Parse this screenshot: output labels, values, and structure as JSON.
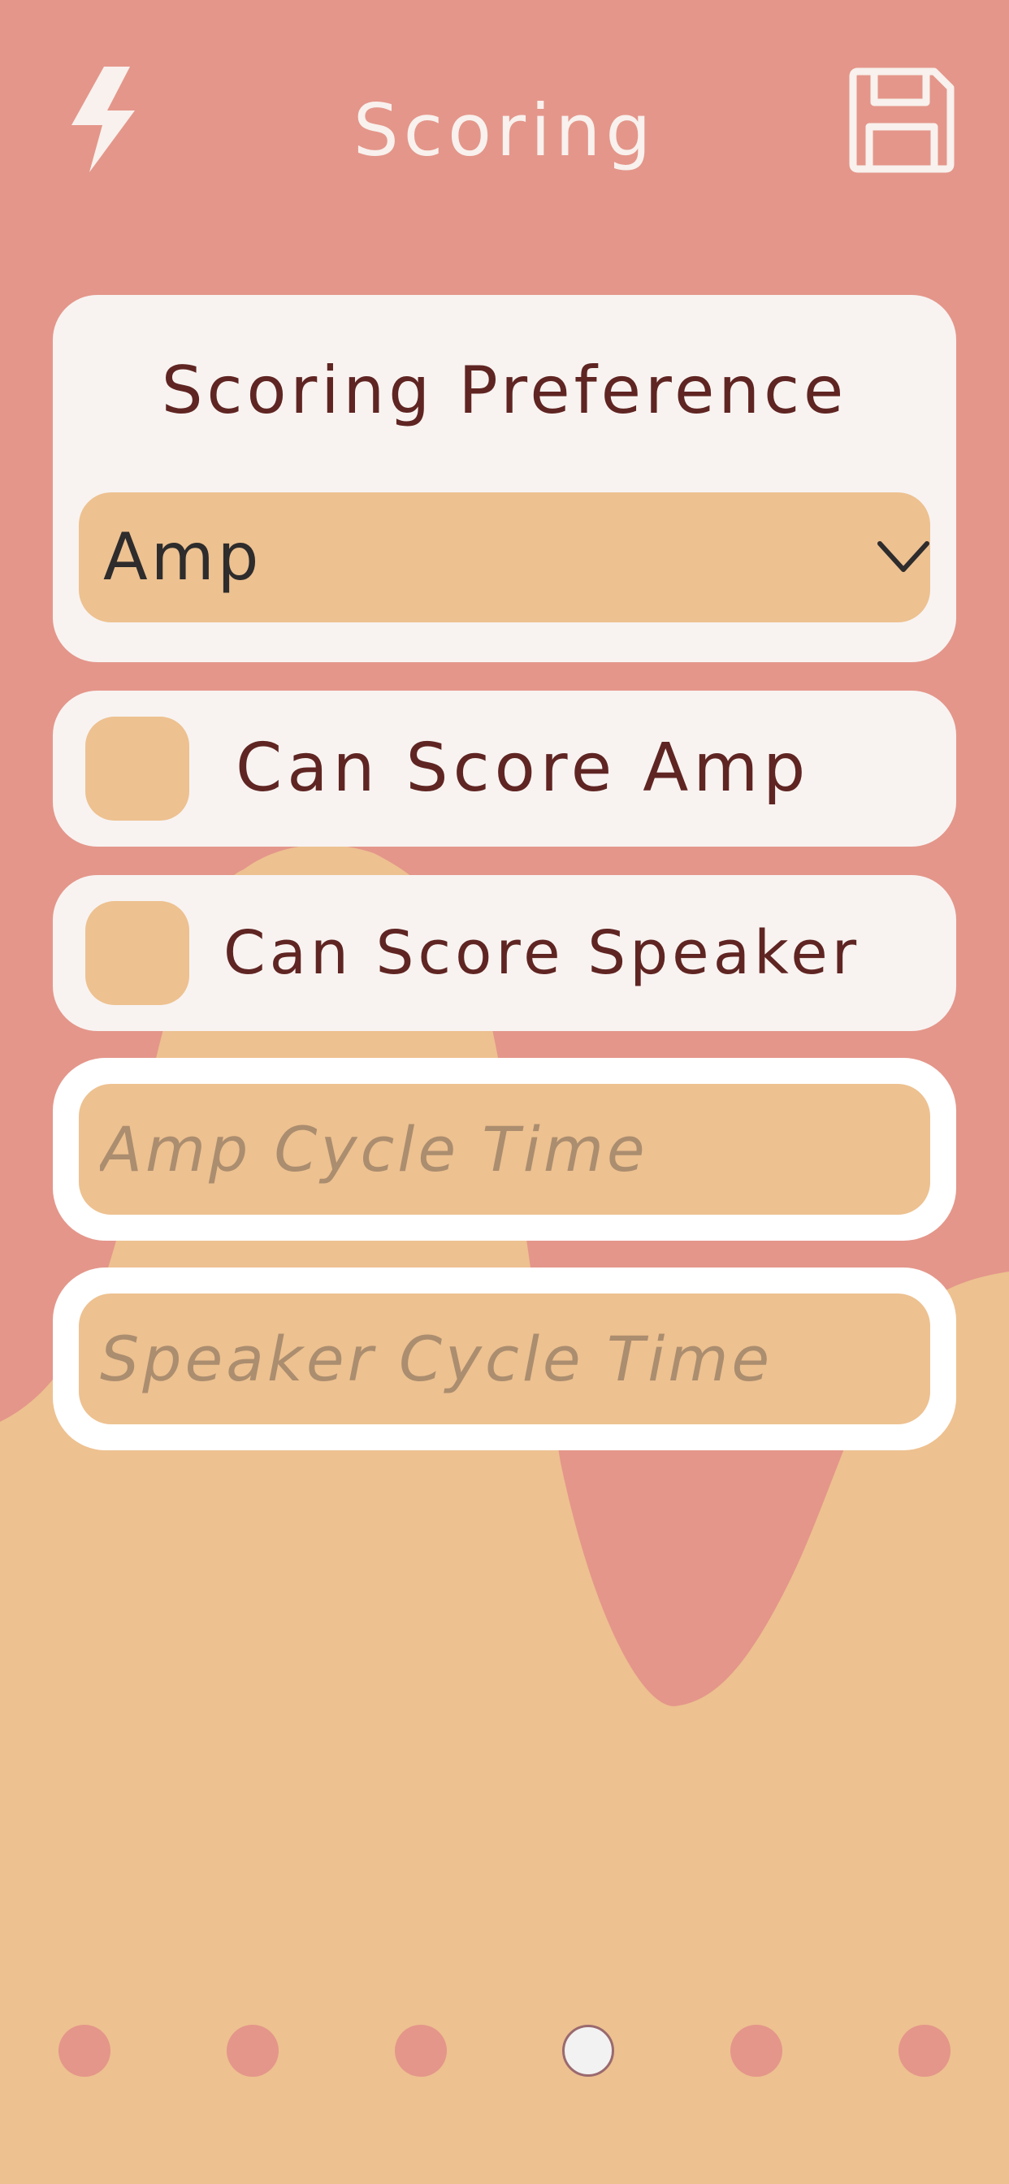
{
  "header": {
    "title": "Scoring",
    "left_icon": "lightning-icon",
    "right_icon": "save-icon"
  },
  "scoring_preference": {
    "title": "Scoring Preference",
    "selected": "Amp"
  },
  "checkboxes": [
    {
      "label": "Can Score Amp",
      "checked": false
    },
    {
      "label": "Can Score Speaker",
      "checked": false
    }
  ],
  "inputs": {
    "amp_cycle_time": {
      "placeholder": "Amp Cycle Time",
      "value": ""
    },
    "speaker_cycle_time": {
      "placeholder": "Speaker Cycle Time",
      "value": ""
    }
  },
  "pager": {
    "page_count": 6,
    "active_index": 3
  },
  "colors": {
    "background_primary": "#E4968A",
    "background_secondary": "#EDC190",
    "card": "#F8F3F1",
    "text_dark": "#5F2522",
    "text_light": "#F8F1ED",
    "placeholder": "#AB8D6F"
  }
}
